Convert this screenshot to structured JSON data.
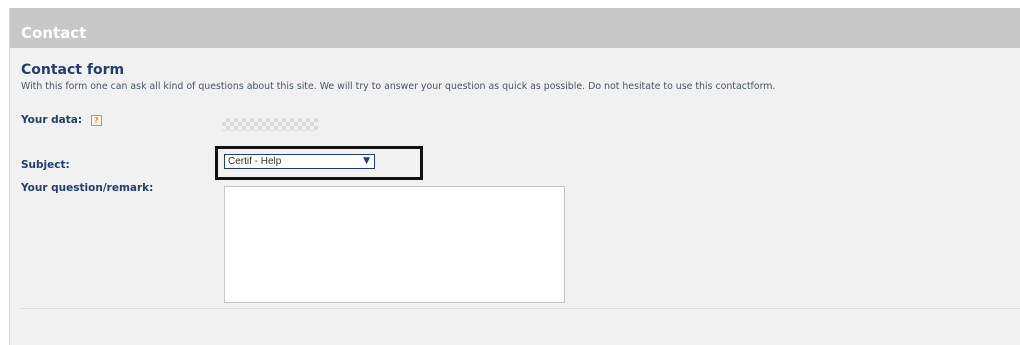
{
  "header": {
    "title": "Contact"
  },
  "form": {
    "title": "Contact form",
    "intro": "With this form one can ask all kind of questions about this site. We will try to answer your question as quick as possible. Do not hesitate to use this contactform.",
    "your_data_label": "Your data:",
    "help_icon": "?",
    "subject_label": "Subject:",
    "subject_value": "Certif - Help",
    "question_label": "Your question/remark:",
    "question_value": ""
  },
  "colors": {
    "header_bg": "#c8c8c8",
    "label_text": "#1f3f73",
    "help_accent": "#e88b2b"
  },
  "icons": {
    "help": "help-icon",
    "dropdown": "chevron-down-icon",
    "resize": "resize-grip-icon"
  }
}
